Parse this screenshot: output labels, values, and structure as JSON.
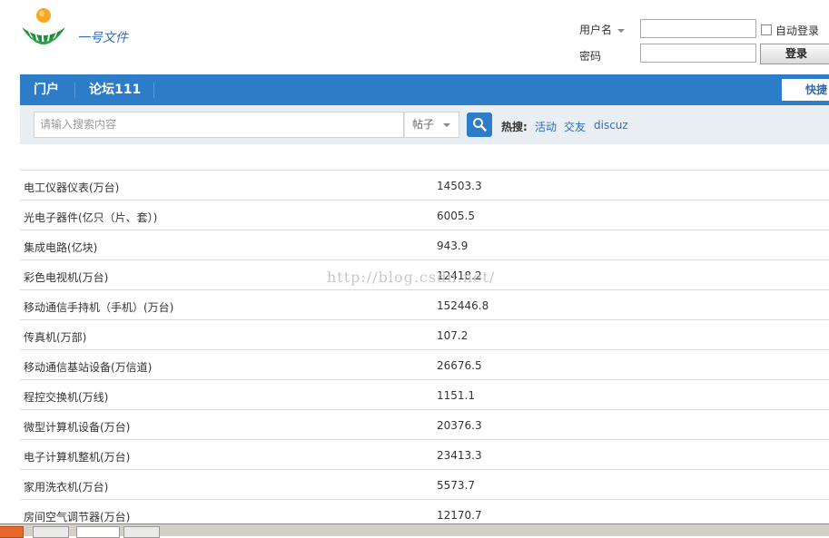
{
  "header": {
    "site_name": "一号文件"
  },
  "login": {
    "username_label": "用户名",
    "password_label": "密码",
    "username_value": "",
    "password_value": "",
    "auto_login_label": "自动登录",
    "login_button": "登录"
  },
  "nav": {
    "items": [
      "门户",
      "论坛111"
    ],
    "quick_label": "快捷"
  },
  "search": {
    "placeholder": "请输入搜索内容",
    "type_selected": "帖子",
    "hot_label": "热搜:",
    "hot_links": [
      "活动",
      "交友",
      "discuz"
    ]
  },
  "table": {
    "rows": [
      {
        "name": "电工仪器仪表(万台)",
        "value": "14503.3"
      },
      {
        "name": "光电子器件(亿只（片、套）)",
        "value": "6005.5"
      },
      {
        "name": "集成电路(亿块)",
        "value": "943.9"
      },
      {
        "name": "彩色电视机(万台)",
        "value": "12418.2"
      },
      {
        "name": "移动通信手持机（手机）(万台)",
        "value": "152446.8"
      },
      {
        "name": "传真机(万部)",
        "value": "107.2"
      },
      {
        "name": "移动通信基站设备(万信道)",
        "value": "26676.5"
      },
      {
        "name": "程控交换机(万线)",
        "value": "1151.1"
      },
      {
        "name": "微型计算机设备(万台)",
        "value": "20376.3"
      },
      {
        "name": "电子计算机整机(万台)",
        "value": "23413.3"
      },
      {
        "name": "家用洗衣机(万台)",
        "value": "5573.7"
      },
      {
        "name": "房间空气调节器(万台)",
        "value": "12170.7"
      }
    ]
  },
  "watermark": "http://blog.csdn.net/",
  "colors": {
    "nav_blue": "#2d7cc8",
    "link_blue": "#2b6cc4",
    "search_bg": "#e9eef3"
  }
}
